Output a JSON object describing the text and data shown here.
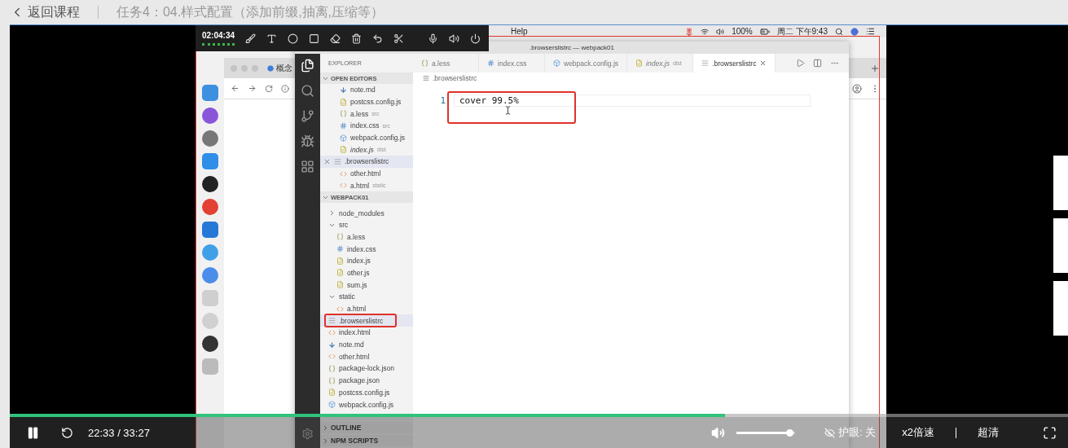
{
  "header": {
    "back": "返回课程",
    "title": "任务4：04.样式配置（添加前缀,抽离,压缩等）"
  },
  "recorder": {
    "time": "02:04:34"
  },
  "menu_bar": {
    "menu": "Help",
    "battery": "100%",
    "clock": "周二 下午9:43"
  },
  "browser": {
    "tab": "概念"
  },
  "vscode": {
    "title": ".browserslistrc — webpack01",
    "explorer": "EXPLORER",
    "open_editors": {
      "title": "OPEN EDITORS",
      "expanded": true,
      "items": [
        {
          "name": "note.md",
          "kind": "md",
          "preview": false,
          "selected": false
        },
        {
          "name": "postcss.config.js",
          "kind": "js",
          "preview": false,
          "selected": false
        },
        {
          "name": "a.less",
          "detail": "src",
          "kind": "braces",
          "preview": false,
          "selected": false
        },
        {
          "name": "index.css",
          "detail": "src",
          "kind": "css",
          "preview": false,
          "selected": false
        },
        {
          "name": "webpack.config.js",
          "kind": "webpack",
          "preview": false,
          "selected": false
        },
        {
          "name": "index.js",
          "detail": "dist",
          "kind": "js",
          "preview": true,
          "selected": false
        },
        {
          "name": ".browserslistrc",
          "kind": "config",
          "preview": false,
          "selected": true
        },
        {
          "name": "other.html",
          "kind": "html",
          "preview": false,
          "selected": false
        },
        {
          "name": "a.html",
          "detail": "static",
          "kind": "html",
          "preview": false,
          "selected": false
        }
      ]
    },
    "project": {
      "title": "WEBPACK01",
      "expanded": true,
      "items": [
        {
          "name": "node_modules",
          "kind": "folder",
          "expanded": false,
          "selected": false,
          "annotated": false
        },
        {
          "name": "src",
          "kind": "folder",
          "expanded": true,
          "selected": false,
          "annotated": false,
          "children": [
            {
              "name": "a.less",
              "kind": "braces",
              "selected": false,
              "annotated": false
            },
            {
              "name": "index.css",
              "kind": "css",
              "selected": false,
              "annotated": false
            },
            {
              "name": "index.js",
              "kind": "js",
              "selected": false,
              "annotated": false
            },
            {
              "name": "other.js",
              "kind": "js",
              "selected": false,
              "annotated": false
            },
            {
              "name": "sum.js",
              "kind": "js",
              "selected": false,
              "annotated": false
            }
          ]
        },
        {
          "name": "static",
          "kind": "folder",
          "expanded": true,
          "selected": false,
          "annotated": false,
          "children": [
            {
              "name": "a.html",
              "kind": "html",
              "selected": false,
              "annotated": false
            }
          ]
        },
        {
          "name": ".browserslistrc",
          "kind": "config",
          "selected": true,
          "annotated": true
        },
        {
          "name": "index.html",
          "kind": "html",
          "selected": false,
          "annotated": false
        },
        {
          "name": "note.md",
          "kind": "md",
          "selected": false,
          "annotated": false
        },
        {
          "name": "other.html",
          "kind": "html",
          "selected": false,
          "annotated": false
        },
        {
          "name": "package-lock.json",
          "kind": "braces",
          "selected": false,
          "annotated": false
        },
        {
          "name": "package.json",
          "kind": "braces",
          "selected": false,
          "annotated": false
        },
        {
          "name": "postcss.config.js",
          "kind": "js",
          "selected": false,
          "annotated": false
        },
        {
          "name": "webpack.config.js",
          "kind": "webpack",
          "selected": false,
          "annotated": false
        }
      ]
    },
    "bottom_sections": [
      {
        "title": "OUTLINE",
        "expanded": false
      },
      {
        "title": "NPM SCRIPTS",
        "expanded": false
      }
    ],
    "tabs": [
      {
        "name": "a.less",
        "kind": "braces",
        "preview": false,
        "selected": false
      },
      {
        "name": "index.css",
        "kind": "css",
        "preview": false,
        "selected": false
      },
      {
        "name": "webpack.config.js",
        "kind": "webpack",
        "preview": false,
        "selected": false
      },
      {
        "name": "index.js",
        "detail": "dist",
        "kind": "js",
        "preview": true,
        "selected": false
      },
      {
        "name": ".browserslistrc",
        "kind": "config",
        "preview": false,
        "selected": true
      }
    ],
    "breadcrumb": ".browserslistrc",
    "lines": [
      {
        "number": "1",
        "text": "cover 99.5%",
        "annotated": true
      }
    ]
  },
  "player": {
    "progress": {
      "level": 0.676
    },
    "time": "22:33 / 33:27",
    "volume": {
      "level": 0.97
    },
    "eye_care": "护眼: 关",
    "speed": "x2倍速",
    "quality": "超清"
  }
}
